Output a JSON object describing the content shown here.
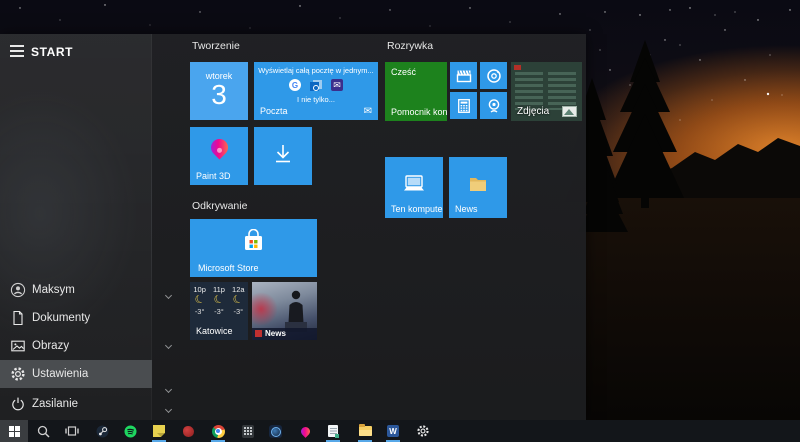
{
  "start_menu": {
    "header_label": "START",
    "sidebar": {
      "items": [
        {
          "label": "Maksym",
          "icon": "user-avatar"
        },
        {
          "label": "Dokumenty",
          "icon": "document"
        },
        {
          "label": "Obrazy",
          "icon": "pictures"
        },
        {
          "label": "Ustawienia",
          "icon": "gear",
          "active": true
        },
        {
          "label": "Zasilanie",
          "icon": "power"
        }
      ]
    },
    "groups": {
      "tworzenie": {
        "title": "Tworzenie"
      },
      "rozrywka": {
        "title": "Rozrywka"
      },
      "odkrywanie": {
        "title": "Odkrywanie"
      }
    },
    "tiles": {
      "calendar": {
        "day_name": "wtorek",
        "day_number": "3"
      },
      "mail": {
        "headline": "Wyświetlaj całą pocztę w jednym...",
        "subline": "I nie tylko...",
        "label": "Poczta"
      },
      "paint3d": {
        "label": "Paint 3D"
      },
      "download": {
        "icon": "download-arrow"
      },
      "store": {
        "label": "Microsoft Store"
      },
      "weather": {
        "times": [
          "10p",
          "11p",
          "12a"
        ],
        "temps": [
          "-3°",
          "-3°",
          "-3°"
        ],
        "city": "Katowice"
      },
      "news_photo": {
        "label": "News"
      },
      "assistant": {
        "greeting": "Cześć",
        "label": "Pomocnik kon..."
      },
      "movies": {
        "icon": "film-clapper"
      },
      "groove": {
        "icon": "music-disc"
      },
      "calculator": {
        "icon": "calculator"
      },
      "camera": {
        "icon": "camera"
      },
      "zdjecia": {
        "label": "Zdjęcia"
      },
      "ten_komputer": {
        "label": "Ten komputer"
      },
      "news_folder": {
        "label": "News"
      }
    }
  },
  "taskbar": {
    "items": [
      "start",
      "search",
      "task-view",
      "steam",
      "spotify",
      "sticky-notes",
      "red-app",
      "chrome",
      "calculator",
      "3d-viewer",
      "paint-3d",
      "notepad",
      "file-explorer",
      "word",
      "settings"
    ],
    "running": [
      "sticky-notes",
      "chrome",
      "notepad",
      "file-explorer",
      "word"
    ],
    "word_letter": "W"
  },
  "icons": {
    "envelope": "✉",
    "moon": "☾",
    "google_letter": "G"
  },
  "colors": {
    "tile_blue": "#2f99e8",
    "calendar_blue": "#4aa5ee",
    "tile_green": "#1d821d",
    "weather_navy": "#1e2a3a",
    "accent": "#57a8e8"
  }
}
